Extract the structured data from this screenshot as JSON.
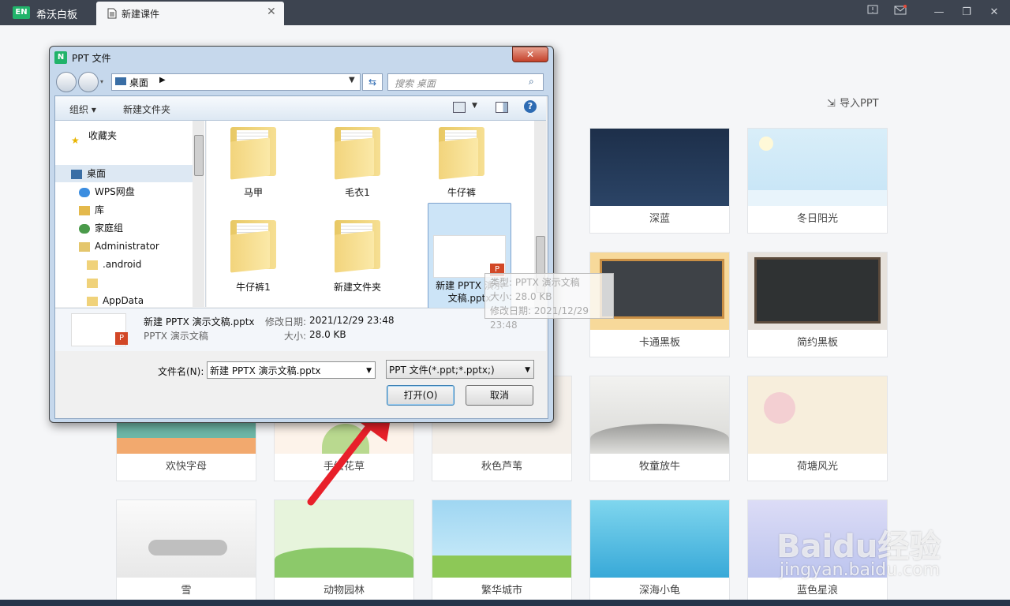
{
  "app": {
    "name": "希沃白板",
    "logo": "EN"
  },
  "tabs": [
    {
      "label": "新建课件"
    }
  ],
  "header": {
    "import_label": "导入PPT"
  },
  "templates": [
    {
      "name": "深蓝"
    },
    {
      "name": "冬日阳光"
    },
    {
      "name": "卡通黑板"
    },
    {
      "name": "简约黑板"
    },
    {
      "name": "欢快字母"
    },
    {
      "name": "手绘花草"
    },
    {
      "name": "秋色芦苇"
    },
    {
      "name": "牧童放牛"
    },
    {
      "name": "荷塘风光"
    },
    {
      "name": "雪"
    },
    {
      "name": "动物园林"
    },
    {
      "name": "繁华城市"
    },
    {
      "name": "深海小龟"
    },
    {
      "name": "蓝色星浪"
    }
  ],
  "dialog": {
    "title": "PPT 文件",
    "address": "桌面",
    "search_placeholder": "搜索 桌面",
    "toolbar": {
      "organize": "组织 ▾",
      "new_folder": "新建文件夹"
    },
    "nav": [
      {
        "label": "收藏夹",
        "icon": "star-icon"
      },
      {
        "label": "桌面",
        "icon": "desktop-icon"
      },
      {
        "label": "WPS网盘",
        "icon": "cloud-icon"
      },
      {
        "label": "库",
        "icon": "library-icon"
      },
      {
        "label": "家庭组",
        "icon": "homegroup-icon"
      },
      {
        "label": "Administrator",
        "icon": "user-folder-icon"
      },
      {
        "label": ".android",
        "icon": "folder-icon"
      },
      {
        "label": "",
        "icon": "folder-icon"
      },
      {
        "label": "AppData",
        "icon": "folder-icon"
      }
    ],
    "files": [
      {
        "name": "马甲"
      },
      {
        "name": "毛衣1"
      },
      {
        "name": "牛仔裤"
      },
      {
        "name": "牛仔裤1"
      },
      {
        "name": "新建文件夹"
      },
      {
        "name": "新建 PPTX 演示文稿.pptx"
      }
    ],
    "tooltip": {
      "type": "类型: PPTX 演示文稿",
      "size": "大小: 28.0 KB",
      "date": "修改日期: 2021/12/29 23:48"
    },
    "details": {
      "name": "新建 PPTX 演示文稿.pptx",
      "date_label": "修改日期:",
      "date": "2021/12/29 23:48",
      "type": "PPTX 演示文稿",
      "size_label": "大小:",
      "size": "28.0 KB"
    },
    "filename_label": "文件名(N):",
    "filename_value": "新建 PPTX 演示文稿.pptx",
    "filter_value": "PPT 文件(*.ppt;*.pptx;)",
    "open_label": "打开(O)",
    "cancel_label": "取消"
  },
  "watermark": {
    "text": "Baidu经验",
    "sub": "jingyan.baidu.com"
  }
}
